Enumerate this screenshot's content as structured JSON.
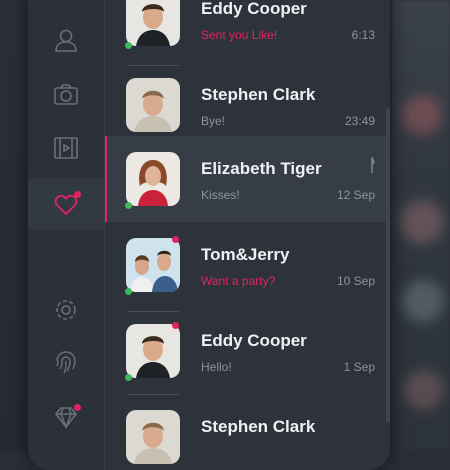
{
  "colors": {
    "accent": "#e0245e",
    "online": "#3dba5a",
    "text": "#eef0f3",
    "muted": "#8e949c"
  },
  "sidebar": {
    "items": [
      {
        "icon": "user-icon",
        "active": false,
        "badge": false
      },
      {
        "icon": "camera-icon",
        "active": false,
        "badge": false
      },
      {
        "icon": "film-icon",
        "active": false,
        "badge": false
      },
      {
        "icon": "heart-icon",
        "active": true,
        "badge": true
      },
      {
        "icon": "gear-icon",
        "active": false,
        "badge": false
      },
      {
        "icon": "fingerprint-icon",
        "active": false,
        "badge": false
      },
      {
        "icon": "diamond-icon",
        "active": false,
        "badge": true
      }
    ]
  },
  "chats": [
    {
      "name": "Eddy Cooper",
      "message": "Sent you Like!",
      "time": "6:13",
      "highlight": true,
      "online": true,
      "unread": true
    },
    {
      "name": "Stephen Clark",
      "message": "Bye!",
      "time": "23:49",
      "highlight": false,
      "online": false,
      "unread": false
    },
    {
      "name": "Elizabeth Tiger",
      "message": "Kisses!",
      "time": "12 Sep",
      "highlight": false,
      "online": true,
      "unread": false,
      "selected": true
    },
    {
      "name": "Tom&Jerry",
      "message": "Want a party?",
      "time": "10 Sep",
      "highlight": true,
      "online": true,
      "unread": true
    },
    {
      "name": "Eddy Cooper",
      "message": "Hello!",
      "time": "1 Sep",
      "highlight": false,
      "online": true,
      "unread": true
    },
    {
      "name": "Stephen Clark",
      "message": "",
      "time": "",
      "highlight": false,
      "online": false,
      "unread": false
    }
  ]
}
